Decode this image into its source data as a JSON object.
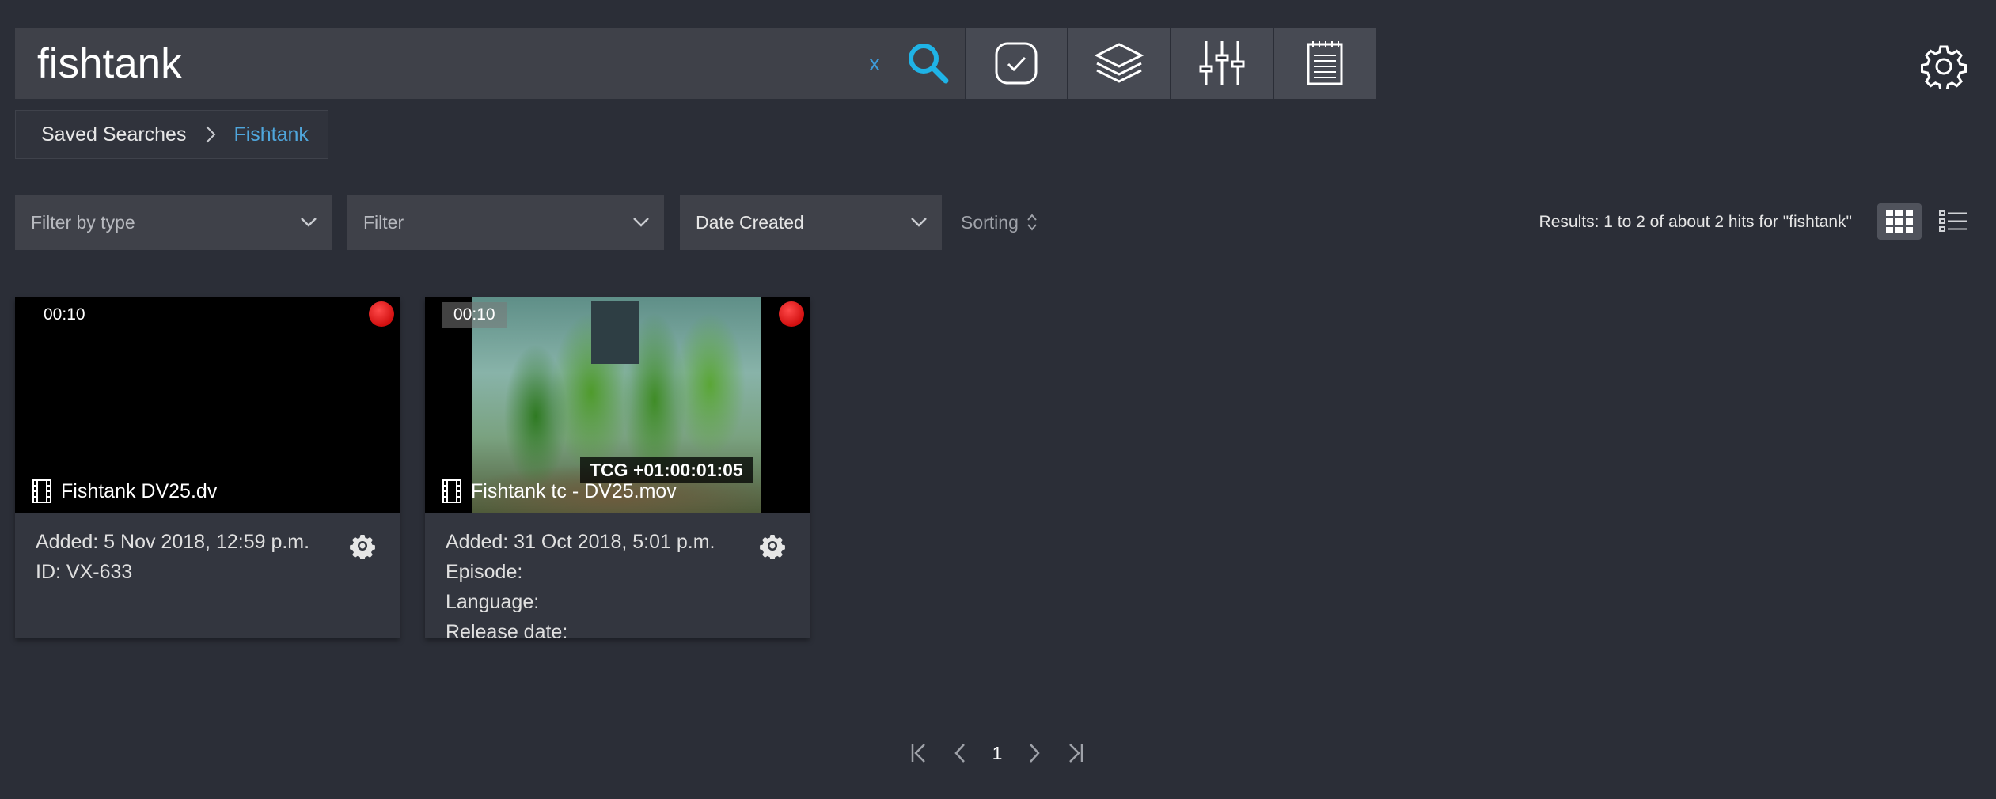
{
  "search": {
    "query": "fishtank",
    "clear_label": "x"
  },
  "breadcrumb": {
    "saved_searches": "Saved Searches",
    "current": "Fishtank"
  },
  "filters": {
    "type_placeholder": "Filter by type",
    "filter_placeholder": "Filter",
    "date_selected": "Date Created",
    "sorting_label": "Sorting"
  },
  "results": {
    "summary": "Results: 1 to 2 of about 2 hits for \"fishtank\""
  },
  "cards": [
    {
      "duration": "00:10",
      "title": "Fishtank DV25.dv",
      "added": "Added: 5 Nov 2018, 12:59 p.m.",
      "id": "ID: VX-633"
    },
    {
      "duration": "00:10",
      "title": "Fishtank tc - DV25.mov",
      "timecode": "TCG +01:00:01:05",
      "added": "Added: 31 Oct 2018, 5:01 p.m.",
      "episode": "Episode:",
      "language": "Language:",
      "release_date": "Release date:"
    }
  ],
  "pagination": {
    "current_page": "1"
  },
  "icons": {
    "search": "search-icon",
    "select": "checkbox-icon",
    "layers": "layers-icon",
    "filters": "sliders-icon",
    "notes": "notepad-icon",
    "settings": "gear-icon",
    "grid_view": "grid-view-icon",
    "list_view": "list-view-icon",
    "media_type": "film-icon",
    "record_status": "red-dot-icon"
  },
  "colors": {
    "background": "#2b2e37",
    "accent": "#3d9ad9",
    "record": "#e0201f"
  }
}
